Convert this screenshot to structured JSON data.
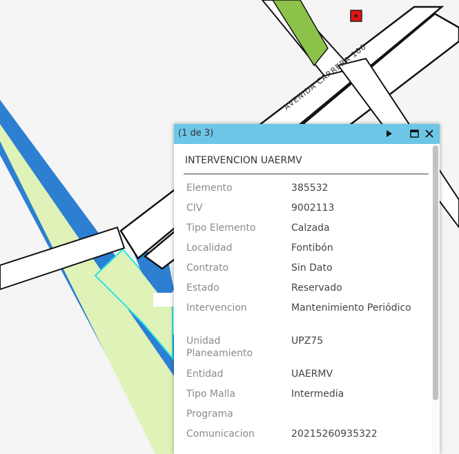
{
  "map": {
    "street_label": "AVENIDA CARRERA 106",
    "colors": {
      "background": "#f5f5f5",
      "road_fill": "#ffffff",
      "road_edge": "#111111",
      "blue_band": "#2d7fd2",
      "green_area": "#dff2b8",
      "green_strip": "#8cc24a",
      "selection_outline": "#22e5e5",
      "marker": "#e31212"
    }
  },
  "popup": {
    "count_text": "(1 de 3)",
    "title": "INTERVENCION UAERMV",
    "header_color": "#6dc6e6",
    "icons": {
      "next": "play-next-icon",
      "maximize": "maximize-icon",
      "close": "close-icon"
    },
    "fields": [
      {
        "label": "Elemento",
        "value": "385532"
      },
      {
        "label": "CIV",
        "value": "9002113"
      },
      {
        "label": "Tipo Elemento",
        "value": "Calzada"
      },
      {
        "label": "Localidad",
        "value": "Fontibón"
      },
      {
        "label": "Contrato",
        "value": "Sin Dato"
      },
      {
        "label": "Estado",
        "value": "Reservado"
      },
      {
        "label": "Intervencion",
        "value": "Mantenimiento Periódico"
      },
      {
        "label": "Unidad Planeamiento",
        "value": "UPZ75"
      },
      {
        "label": "Entidad",
        "value": "UAERMV"
      },
      {
        "label": "Tipo Malla",
        "value": "Intermedia"
      },
      {
        "label": "Programa",
        "value": ""
      },
      {
        "label": "Comunicacion",
        "value": "20215260935322"
      }
    ]
  }
}
